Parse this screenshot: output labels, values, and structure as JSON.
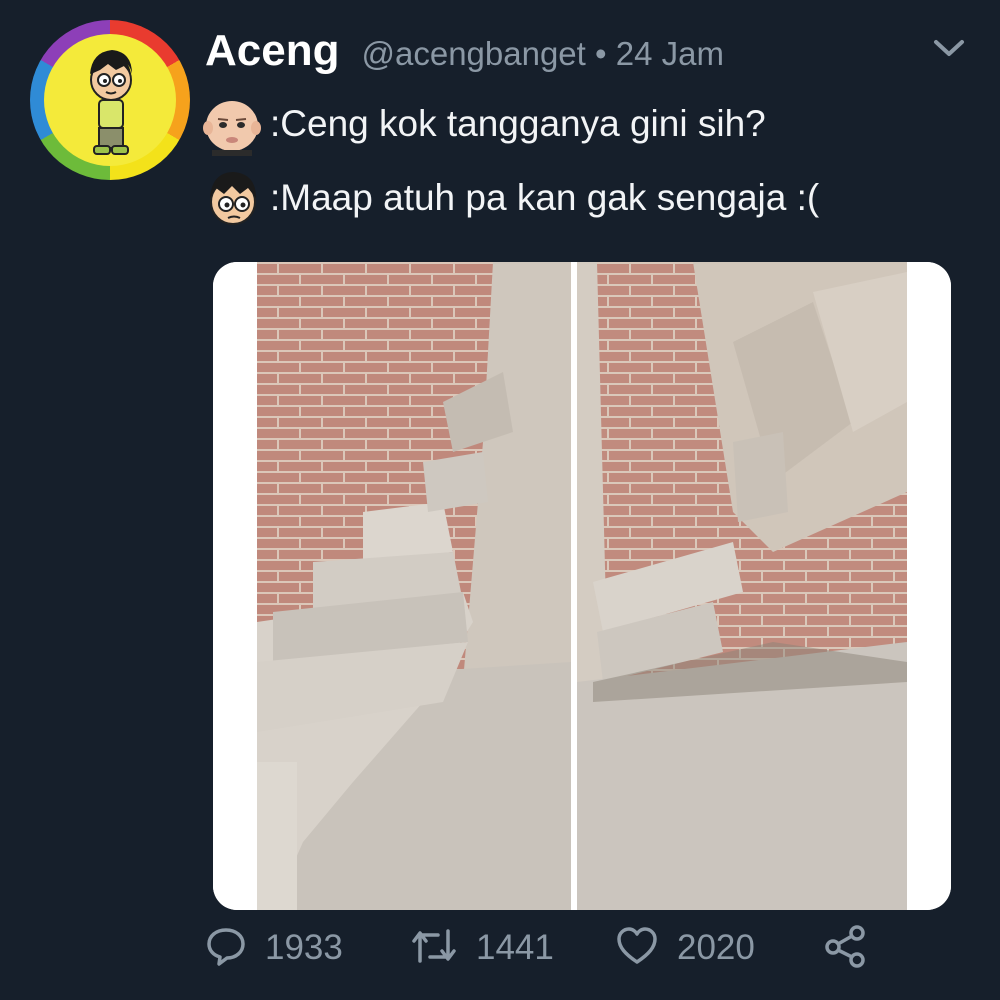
{
  "tweet": {
    "author": "Aceng",
    "meta": "@acengbanget • 24 Jam",
    "messages": [
      {
        "speaker_icon": "baby-face-icon",
        "text": ":Ceng kok tangganya gini sih?"
      },
      {
        "speaker_icon": "cartoon-boy-face-icon",
        "text": ":Maap atuh pa kan gak sengaja :("
      }
    ],
    "media_icon": "stairs-photo",
    "actions": {
      "reply": {
        "icon": "reply-icon",
        "count": "1933"
      },
      "retweet": {
        "icon": "retweet-icon",
        "count": "1441"
      },
      "like": {
        "icon": "heart-icon",
        "count": "2020"
      },
      "share": {
        "icon": "share-icon"
      }
    }
  },
  "colors": {
    "background": "#161f2b",
    "text": "#ffffff",
    "muted": "#8b98a5",
    "avatar_ring": [
      "#e93b2f",
      "#f6a21c",
      "#f3e21a",
      "#6dbb3a",
      "#2f8bd6",
      "#8d3fb8"
    ]
  }
}
